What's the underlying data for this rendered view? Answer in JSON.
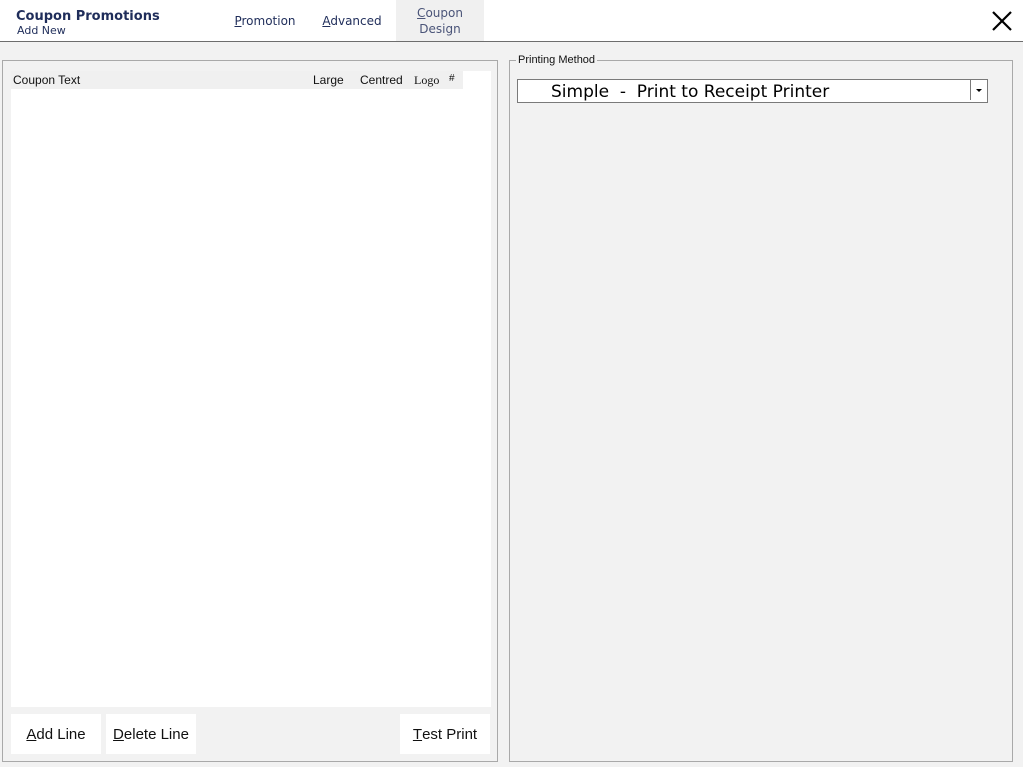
{
  "header": {
    "app_title": "Coupon Promotions",
    "app_subtitle": "Add New",
    "tabs": [
      {
        "underline": "P",
        "rest": "romotion"
      },
      {
        "underline": "A",
        "rest": "dvanced"
      },
      {
        "underline": "C",
        "rest_line1": "oupon",
        "line2": "Design"
      }
    ]
  },
  "coupon_grid": {
    "columns": [
      "Coupon Text",
      "Large",
      "Centred",
      "Logo",
      "#"
    ]
  },
  "buttons": {
    "add_line": {
      "underline": "A",
      "rest": "dd Line"
    },
    "delete_line": {
      "underline": "D",
      "rest": "elete Line"
    },
    "test_print": {
      "underline": "T",
      "rest": "est Print"
    }
  },
  "printing_method": {
    "label": "Printing Method",
    "selected": "Simple  -  Print to Receipt Printer"
  },
  "icons": {
    "close": "close-icon",
    "dropdown": "chevron-down-icon"
  }
}
